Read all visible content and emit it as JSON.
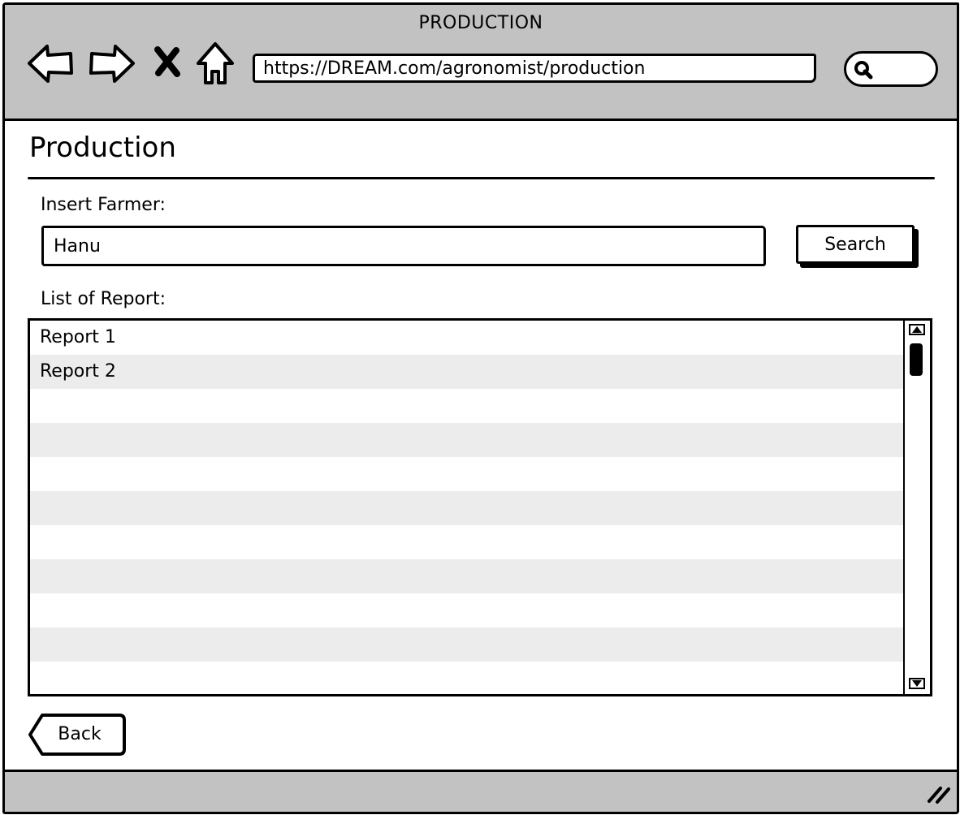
{
  "window": {
    "title": "PRODUCTION",
    "url": "https://DREAM.com/agronomist/production"
  },
  "toolbar": {
    "icons": [
      "back-arrow-icon",
      "forward-arrow-icon",
      "close-x-icon",
      "home-icon",
      "search-icon"
    ]
  },
  "page": {
    "title": "Production",
    "farmer_label": "Insert Farmer:",
    "farmer_value": "Hanu",
    "search_label": "Search",
    "list_label": "List of Report:",
    "reports": [
      "Report 1",
      "Report 2"
    ],
    "back_label": "Back"
  },
  "colors": {
    "chrome": "#c2c2c2",
    "stripe": "#ececec",
    "ink": "#000000"
  }
}
